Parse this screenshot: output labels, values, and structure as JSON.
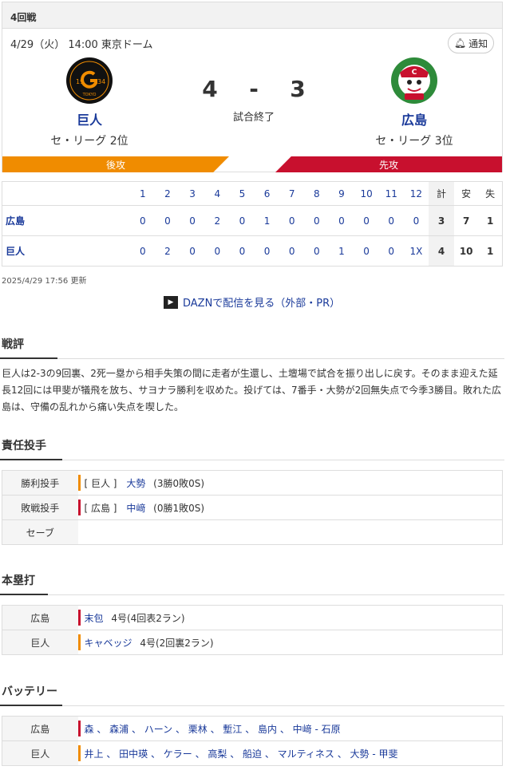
{
  "header": {
    "round": "4回戦",
    "date_venue": "4/29（火） 14:00 東京ドーム",
    "notify_label": "通知"
  },
  "home": {
    "name": "巨人",
    "rank": "セ・リーグ 2位",
    "score": "4",
    "side": "後攻",
    "logo_text": "TOKYO",
    "logo_year_left": "19",
    "logo_year_right": "34"
  },
  "away": {
    "name": "広島",
    "rank": "セ・リーグ 3位",
    "score": "3",
    "side": "先攻"
  },
  "score_sep": "-",
  "status": "試合終了",
  "scoreboard": {
    "innings": [
      "1",
      "2",
      "3",
      "4",
      "5",
      "6",
      "7",
      "8",
      "9",
      "10",
      "11",
      "12"
    ],
    "total_label": "計",
    "hits_label": "安",
    "errors_label": "失",
    "rows": [
      {
        "team": "広島",
        "runs": [
          "0",
          "0",
          "0",
          "2",
          "0",
          "1",
          "0",
          "0",
          "0",
          "0",
          "0",
          "0"
        ],
        "total": "3",
        "hits": "7",
        "errors": "1"
      },
      {
        "team": "巨人",
        "runs": [
          "0",
          "2",
          "0",
          "0",
          "0",
          "0",
          "0",
          "0",
          "1",
          "0",
          "0",
          "1X"
        ],
        "total": "4",
        "hits": "10",
        "errors": "1"
      }
    ]
  },
  "updated": "2025/4/29 17:56 更新",
  "dazn_link": "DAZNで配信を見る（外部・PR）",
  "review": {
    "title": "戦評",
    "text": "巨人は2-3の9回裏、2死一塁から相手失策の間に走者が生還し、土壇場で試合を振り出しに戻す。そのまま迎えた延長12回には甲斐が犠飛を放ち、サヨナラ勝利を収めた。投げては、7番手・大勢が2回無失点で今季3勝目。敗れた広島は、守備の乱れから痛い失点を喫した。"
  },
  "pitchers": {
    "title": "責任投手",
    "win_label": "勝利投手",
    "win_team": "[ 巨人 ]",
    "win_name": "大勢",
    "win_record": "(3勝0敗0S)",
    "lose_label": "敗戦投手",
    "lose_team": "[ 広島 ]",
    "lose_name": "中﨑",
    "lose_record": "(0勝1敗0S)",
    "save_label": "セーブ"
  },
  "homeruns": {
    "title": "本塁打",
    "rows": [
      {
        "team": "広島",
        "player": "末包",
        "detail": "4号(4回表2ラン)"
      },
      {
        "team": "巨人",
        "player": "キャベッジ",
        "detail": "4号(2回裏2ラン)"
      }
    ]
  },
  "battery": {
    "title": "バッテリー",
    "rows": [
      {
        "team": "広島",
        "text": "森 、 森浦 、 ハーン 、 栗林 、 塹江 、 島内 、 中﨑 - 石原"
      },
      {
        "team": "巨人",
        "text": "井上 、 田中瑛 、 ケラー 、 高梨 、 船迫 、 マルティネス 、 大勢 - 甲斐"
      }
    ]
  },
  "colors": {
    "giants": "#f08c00",
    "carp": "#c8102e",
    "link": "#1a3a9a"
  }
}
